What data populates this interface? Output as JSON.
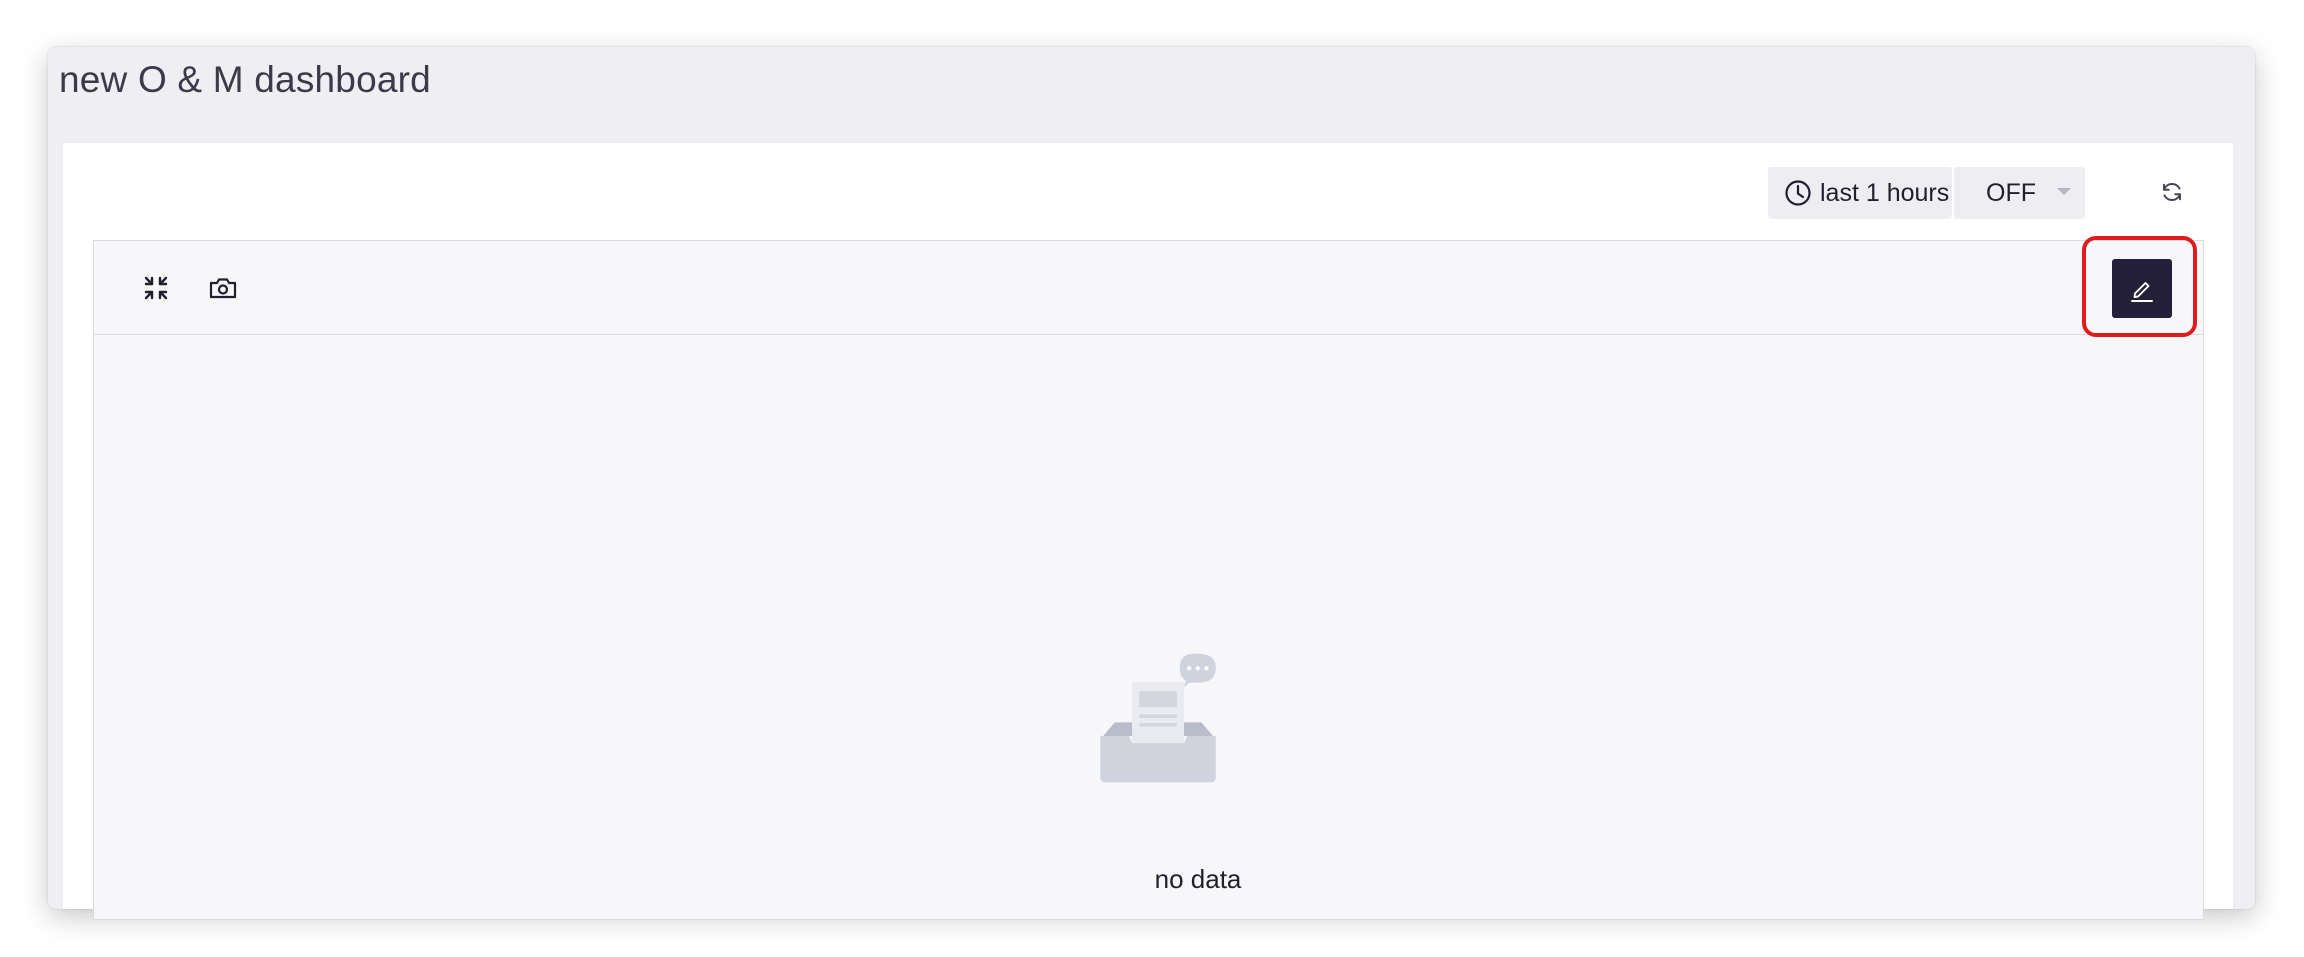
{
  "dashboard": {
    "title": "new O & M dashboard"
  },
  "toolbar": {
    "time_range": "last 1 hours",
    "auto_refresh": "OFF",
    "icons": {
      "time": "clock-icon",
      "refresh": "refresh-icon"
    }
  },
  "panel": {
    "icons": [
      "fullscreen-icon",
      "camera-icon",
      "edit-icon"
    ],
    "empty_text": "no data"
  },
  "colors": {
    "edit_button_bg": "#24203a",
    "highlight": "#e01b1b"
  }
}
